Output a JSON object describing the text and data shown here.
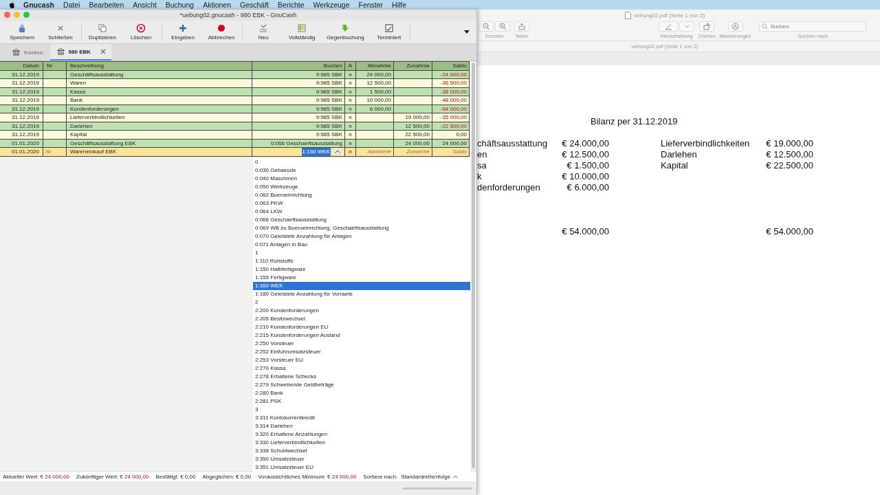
{
  "menu_bar": [
    "Gnucash",
    "Datei",
    "Bearbeiten",
    "Ansicht",
    "Buchung",
    "Aktionen",
    "Geschäft",
    "Berichte",
    "Werkzeuge",
    "Fenster",
    "Hilfe"
  ],
  "window": {
    "title": "*uebung02.gnucash - 980 EBK - GnuCash"
  },
  "toolbar": [
    [
      {
        "kind": "save",
        "label": "Speichern"
      },
      {
        "kind": "close",
        "label": "Schließen"
      }
    ],
    [
      {
        "kind": "duplicate",
        "label": "Duplizieren"
      },
      {
        "kind": "delete",
        "label": "Löschen"
      }
    ],
    [
      {
        "kind": "enter",
        "label": "Eingeben"
      },
      {
        "kind": "cancel",
        "label": "Abbrechen"
      }
    ],
    [
      {
        "kind": "new",
        "label": "Neu"
      },
      {
        "kind": "full",
        "label": "Vollständig"
      },
      {
        "kind": "jump",
        "label": "Gegenbuchung"
      },
      {
        "kind": "scheduled",
        "label": "Terminiert"
      }
    ]
  ],
  "tabs": [
    {
      "label": "Konten",
      "selected": false,
      "closable": false
    },
    {
      "label": "980 EBK",
      "selected": true,
      "closable": true
    }
  ],
  "register": {
    "columns": [
      "Datum",
      "Nr",
      "Beschreibung",
      "Buchen",
      "A",
      "Abnahme",
      "Zunahme",
      "Saldo"
    ],
    "rows": [
      {
        "date": "31.12.2019",
        "num": "",
        "description": "Geschäftsausstattung",
        "transfer": "9:985 SBK",
        "reconciled": "n",
        "decrease": "24 000,00",
        "increase": "",
        "balance": "-24 000,00",
        "negative": true
      },
      {
        "date": "31.12.2019",
        "num": "",
        "description": "Waren",
        "transfer": "9:985 SBK",
        "reconciled": "n",
        "decrease": "12 500,00",
        "increase": "",
        "balance": "-36 500,00",
        "negative": true
      },
      {
        "date": "31.12.2019",
        "num": "",
        "description": "Kassa",
        "transfer": "9:985 SBK",
        "reconciled": "n",
        "decrease": "1 500,00",
        "increase": "",
        "balance": "-38 000,00",
        "negative": true
      },
      {
        "date": "31.12.2019",
        "num": "",
        "description": "Bank",
        "transfer": "9:985 SBK",
        "reconciled": "n",
        "decrease": "10 000,00",
        "increase": "",
        "balance": "-48 000,00",
        "negative": true
      },
      {
        "date": "31.12.2019",
        "num": "",
        "description": "Kundenforderungen",
        "transfer": "9:985 SBK",
        "reconciled": "n",
        "decrease": "6 000,00",
        "increase": "",
        "balance": "-54 000,00",
        "negative": true
      },
      {
        "date": "31.12.2019",
        "num": "",
        "description": "Lieferverbindlichkeiten",
        "transfer": "9:985 SBK",
        "reconciled": "n",
        "decrease": "",
        "increase": "19 000,00",
        "balance": "-35 000,00",
        "negative": true
      },
      {
        "date": "31.12.2019",
        "num": "",
        "description": "Darlehen",
        "transfer": "9:985 SBK",
        "reconciled": "n",
        "decrease": "",
        "increase": "12 500,00",
        "balance": "-22 500,00",
        "negative": true
      },
      {
        "date": "31.12.2019",
        "num": "",
        "description": "Kapital",
        "transfer": "9:985 SBK",
        "reconciled": "n",
        "decrease": "",
        "increase": "22 500,00",
        "balance": "0,00",
        "negative": false
      },
      {
        "date": "01.01.2020",
        "num": "",
        "description": "Geschäftsausstattung EBK",
        "transfer": "0:066 Geschaeftsausstattung",
        "reconciled": "n",
        "decrease": "",
        "increase": "24 000,00",
        "balance": "24 000,00",
        "negative": false
      }
    ],
    "entry_row": {
      "date": "01.01.2020",
      "num_placeholder": "Nr",
      "description": "Wareneinkauf EBK",
      "transfer": "1:160 WEK",
      "reconciled": "n",
      "decrease_placeholder": "Abnahme",
      "increase_placeholder": "Zunahme",
      "balance_placeholder": "Saldo"
    }
  },
  "account_dropdown": [
    {
      "label": "0",
      "selected": false
    },
    {
      "label": "0:030 Gebaeude",
      "selected": false
    },
    {
      "label": "0:040 Maschinen",
      "selected": false
    },
    {
      "label": "0:050 Werkzeuge",
      "selected": false
    },
    {
      "label": "0:062 Bueroeinrichtung",
      "selected": false
    },
    {
      "label": "0:063 PKW",
      "selected": false
    },
    {
      "label": "0:064 LKW",
      "selected": false
    },
    {
      "label": "0:066 Geschaeftsausstattung",
      "selected": false
    },
    {
      "label": "0:069 WB zu Bueroeinrichtung, Geschaeftsausstattung",
      "selected": false
    },
    {
      "label": "0:070 Geleistete Anzahlung für Anlagen",
      "selected": false
    },
    {
      "label": "0:071 Anlagen in Bau",
      "selected": false
    },
    {
      "label": "1",
      "selected": false
    },
    {
      "label": "1:110 Rohstoffe",
      "selected": false
    },
    {
      "label": "1:150 Halbfertigware",
      "selected": false
    },
    {
      "label": "1:155 Fertigware",
      "selected": false
    },
    {
      "label": "1:160 WEK",
      "selected": true
    },
    {
      "label": "1:180 Geleistete Anzahlung für Vorraete",
      "selected": false
    },
    {
      "label": "2",
      "selected": false
    },
    {
      "label": "2:200 Kundenforderungen",
      "selected": false
    },
    {
      "label": "2:205 Besitzwechsel",
      "selected": false
    },
    {
      "label": "2:210 Kundenforderungen EU",
      "selected": false
    },
    {
      "label": "2:215 Kundenforderungen Ausland",
      "selected": false
    },
    {
      "label": "2:250 Vorsteuer",
      "selected": false
    },
    {
      "label": "2:252 Einfuhrumsatzsteuer",
      "selected": false
    },
    {
      "label": "2:253 Vorsteuer EU",
      "selected": false
    },
    {
      "label": "2:270 Kassa",
      "selected": false
    },
    {
      "label": "2:278 Erhaltene Schecks",
      "selected": false
    },
    {
      "label": "2:279 Schwebende Geldbeträge",
      "selected": false
    },
    {
      "label": "2:280 Bank",
      "selected": false
    },
    {
      "label": "2:281 PSK",
      "selected": false
    },
    {
      "label": "3",
      "selected": false
    },
    {
      "label": "3:311 Kontokorrentkredit",
      "selected": false
    },
    {
      "label": "3:314 Darlehen",
      "selected": false
    },
    {
      "label": "3:320 Erhaltene Anzahlungen",
      "selected": false
    },
    {
      "label": "3:330 Lieferverbindlichkeiten",
      "selected": false
    },
    {
      "label": "3:338 Schuldwechsel",
      "selected": false
    },
    {
      "label": "3:350 Umsatzsteuer",
      "selected": false
    },
    {
      "label": "3:351 Umsatzsteuer EU",
      "selected": false
    }
  ],
  "status_bar": {
    "items": [
      {
        "label": "Aktueller Wert:",
        "value": "€ 24 000,00",
        "highlighted": true
      },
      {
        "label": "Zukünftiger Wert:",
        "value": "€ 24 000,00",
        "highlighted": true
      },
      {
        "label": "Bestätigt:",
        "value": "€ 0,00",
        "highlighted": false
      },
      {
        "label": "Abgeglichen:",
        "value": "€ 0,00",
        "highlighted": false
      },
      {
        "label": "Voraussichtliches Minimum:",
        "value": "€ 24 000,00",
        "highlighted": true
      }
    ],
    "sort_label": "Sortiere nach:",
    "sort_value": "Standardreihenfolge"
  },
  "pdf_viewer": {
    "title": "uebung02.pdf (Seite 1 von 2)",
    "toolbar": [
      {
        "kind": "zoom",
        "label": "Zoomen"
      },
      {
        "kind": "share",
        "label": "Teilen"
      },
      {
        "kind": "highlight",
        "label": "Hervorhebung"
      },
      {
        "kind": "rotate",
        "label": "Drehen"
      },
      {
        "kind": "markup",
        "label": "Markierungen"
      }
    ],
    "search": {
      "placeholder": "Suchen",
      "label": "Suchen nach"
    },
    "subtitle": "uebung02.pdf (Seite 1 von 2)",
    "page": {
      "heading": "Bilanz per 31.12.2019",
      "assets": [
        {
          "label": "chäftsausstattung",
          "amount": "€ 24.000,00"
        },
        {
          "label": "en",
          "amount": "€ 12.500,00"
        },
        {
          "label": "sa",
          "amount": "€ 1.500,00"
        },
        {
          "label": "k",
          "amount": "€ 10.000,00"
        },
        {
          "label": "denforderungen",
          "amount": "€ 6.000,00"
        }
      ],
      "liabilities": [
        {
          "label": "Lieferverbindlichkeiten",
          "amount": "€ 19.000,00"
        },
        {
          "label": "Darlehen",
          "amount": "€ 12.500,00"
        },
        {
          "label": "Kapital",
          "amount": "€ 22.500,00"
        }
      ],
      "asset_total": "€ 54.000,00",
      "liability_total": "€ 54.000,00"
    }
  }
}
